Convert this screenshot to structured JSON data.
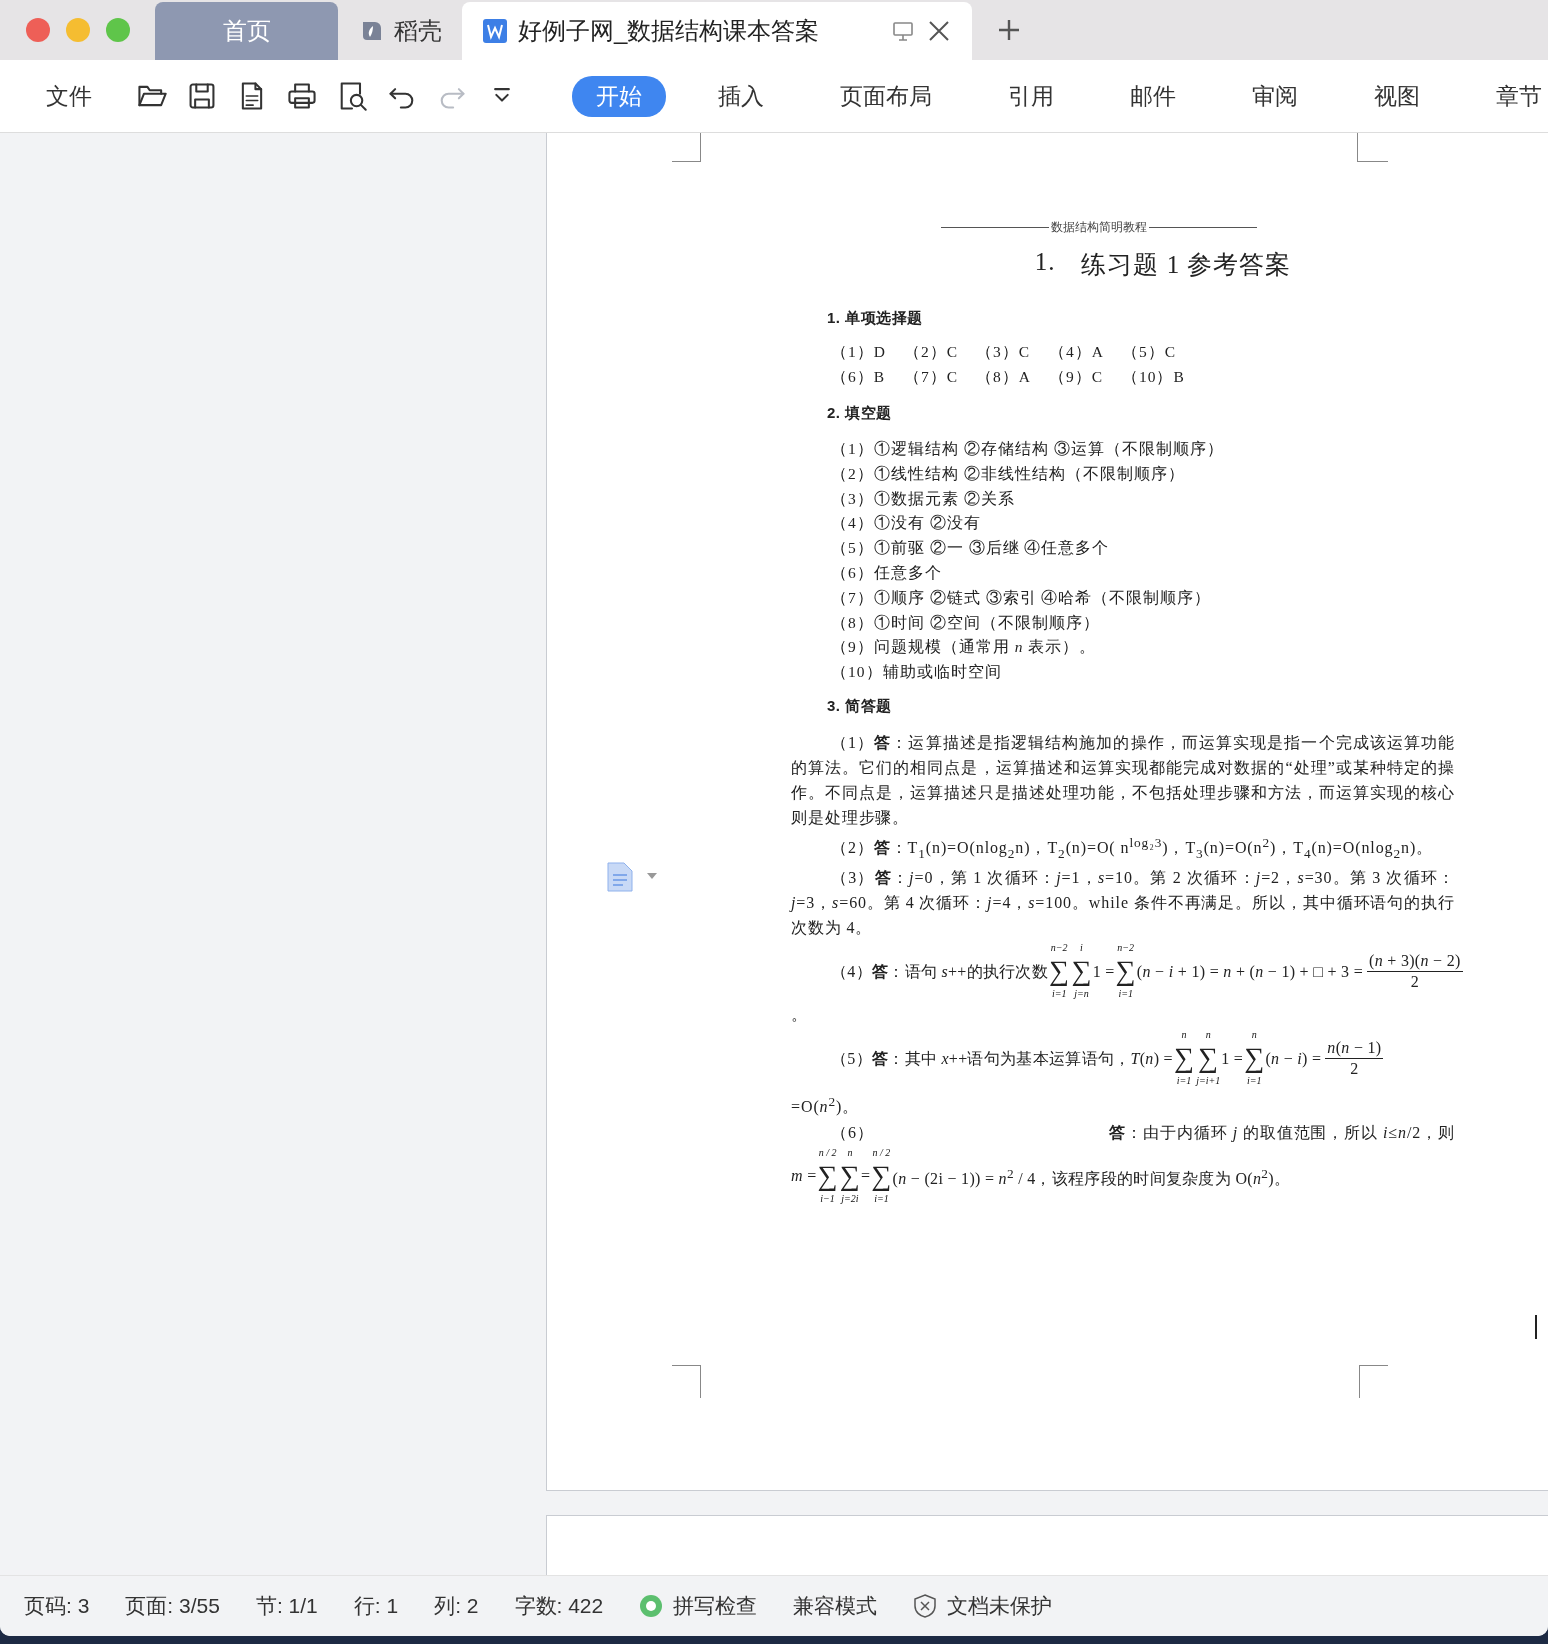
{
  "window": {
    "tabs": [
      {
        "kind": "home",
        "label": "首页",
        "selected": false
      },
      {
        "kind": "docer",
        "label": "稻壳",
        "selected": false
      },
      {
        "kind": "doc",
        "label": "好例子网_数据结构课本答案",
        "selected": true
      }
    ]
  },
  "toolbar": {
    "menu_label": "文件",
    "quick_access": [
      {
        "kind": "open",
        "disabled": false
      },
      {
        "kind": "save",
        "disabled": false
      },
      {
        "kind": "pdf",
        "disabled": false
      },
      {
        "kind": "print",
        "disabled": false
      },
      {
        "kind": "preview",
        "disabled": false
      },
      {
        "kind": "undo",
        "disabled": false
      },
      {
        "kind": "redo",
        "disabled": true
      },
      {
        "kind": "more",
        "disabled": false
      }
    ],
    "ribbon_tabs": [
      {
        "label": "开始",
        "selected": true
      },
      {
        "label": "插入",
        "selected": false
      },
      {
        "label": "页面布局",
        "selected": false
      },
      {
        "label": "引用",
        "selected": false
      },
      {
        "label": "邮件",
        "selected": false
      },
      {
        "label": "审阅",
        "selected": false
      },
      {
        "label": "视图",
        "selected": false
      },
      {
        "label": "章节",
        "selected": false
      }
    ]
  },
  "document": {
    "running_header": "数据结构简明教程",
    "title": {
      "number": "1.",
      "text": "练习题 1 参考答案"
    },
    "sections": [
      {
        "kind": "choices",
        "heading": "1. 单项选择题",
        "rows": [
          [
            "（1）D",
            "（2）C",
            "（3）C",
            "（4）A",
            "（5）C"
          ],
          [
            "（6）B",
            "（7）C",
            "（8）A",
            "（9）C",
            "（10）B"
          ]
        ]
      },
      {
        "kind": "list",
        "heading": "2. 填空题",
        "items": [
          "（1）①逻辑结构 ②存储结构 ③运算（不限制顺序）",
          "（2）①线性结构 ②非线性结构（不限制顺序）",
          "（3）①数据元素 ②关系",
          "（4）①没有 ②没有",
          "（5）①前驱 ②一 ③后继 ④任意多个",
          "（6）任意多个",
          "（7）①顺序 ②链式 ③索引 ④哈希（不限制顺序）",
          "（8）①时间 ②空间（不限制顺序）",
          "（9）问题规模（通常用 *n* 表示）。",
          "（10）辅助或临时空间"
        ]
      },
      {
        "kind": "answers",
        "heading": "3. 简答题",
        "items": [
          {
            "kind": "para",
            "indent": true,
            "text": "（1）**答**：运算描述是指逻辑结构施加的操作，而运算实现是指一个完成该运算功能的算法。它们的相同点是，运算描述和运算实现都能完成对数据的“处理”或某种特定的操作。不同点是，运算描述只是描述处理功能，不包括处理步骤和方法，而运算实现的核心则是处理步骤。"
          },
          {
            "kind": "para",
            "indent": true,
            "text": "（2）**答**：T$_{1}$(n)=O(nlog$_{2}$n)，T$_{2}$(n)=O( n$^{log₂3}$)，T$_{3}$(n)=O(n$^{2}$)，T$_{4}$(n)=O(nlog$_{2}$n)。"
          },
          {
            "kind": "para",
            "indent": true,
            "text": "（3）**答**：*j*=0，第 1 次循环：*j*=1，*s*=10。第 2 次循环：*j*=2，*s*=30。第 3 次循环：*j*=3，*s*=60。第 4 次循环：*j*=4，*s*=100。while 条件不再满足。所以，其中循环语句的执行次数为 4。"
          },
          {
            "kind": "math",
            "indent": true,
            "segments": [
              {
                "kind": "text",
                "text": "（4）**答**：语句 *s*++的执行次数"
              },
              {
                "kind": "sum",
                "symbol": "∑",
                "upper": "n−2",
                "lower": "i=1"
              },
              {
                "kind": "sum",
                "symbol": "∑",
                "upper": "i",
                "lower": "j=n"
              },
              {
                "kind": "text",
                "text": "1 ="
              },
              {
                "kind": "sum",
                "symbol": "∑",
                "upper": "n−2",
                "lower": "i=1"
              },
              {
                "kind": "text",
                "text": "(*n* − *i* + 1) = *n* + (*n* − 1) + □ + 3 ="
              },
              {
                "kind": "frac",
                "num": "(*n* + 3)(*n* − 2)",
                "den": "2"
              }
            ]
          },
          {
            "kind": "para",
            "indent": false,
            "text": "。"
          },
          {
            "kind": "math",
            "indent": true,
            "segments": [
              {
                "kind": "text",
                "text": "（5）**答**：其中 *x*++语句为基本运算语句，"
              },
              {
                "kind": "text",
                "text": "*T*(*n*) ="
              },
              {
                "kind": "sum",
                "symbol": "∑",
                "upper": "n",
                "lower": "i=1"
              },
              {
                "kind": "sum",
                "symbol": "∑",
                "upper": "n",
                "lower": "j=i+1"
              },
              {
                "kind": "text",
                "text": "1 ="
              },
              {
                "kind": "sum",
                "symbol": "∑",
                "upper": "n",
                "lower": "i=1"
              },
              {
                "kind": "text",
                "text": "(*n* − *i*) ="
              },
              {
                "kind": "frac",
                "num": "*n*(*n* − 1)",
                "den": "2"
              }
            ]
          },
          {
            "kind": "para",
            "indent": false,
            "text": "=O(*n*$^{2}$)。"
          },
          {
            "kind": "split",
            "left": "（6）",
            "right": "**答**：由于内循环 *j* 的取值范围，所以 *i*≤*n*/2，则"
          },
          {
            "kind": "math",
            "indent": false,
            "segments": [
              {
                "kind": "text",
                "text": "*m* ="
              },
              {
                "kind": "sum",
                "symbol": "∑",
                "upper": "n / 2",
                "lower": "i−1"
              },
              {
                "kind": "sum",
                "symbol": "∑",
                "upper": "n",
                "lower": "j=2i"
              },
              {
                "kind": "text",
                "text": "="
              },
              {
                "kind": "sum",
                "symbol": "∑",
                "upper": "n / 2",
                "lower": "i=1"
              },
              {
                "kind": "text",
                "text": "(*n* − (2i − 1)) = *n*$^{2}$ / 4，"
              },
              {
                "kind": "text",
                "text": "该程序段的时间复杂度为 O(*n*$^{2}$)。"
              }
            ]
          }
        ]
      }
    ]
  },
  "status_bar": [
    {
      "kind": "text",
      "label": "页码: 3"
    },
    {
      "kind": "text",
      "label": "页面: 3/55"
    },
    {
      "kind": "text",
      "label": "节: 1/1"
    },
    {
      "kind": "text",
      "label": "行: 1"
    },
    {
      "kind": "text",
      "label": "列: 2"
    },
    {
      "kind": "text",
      "label": "字数: 422"
    },
    {
      "kind": "spell",
      "label": "拼写检查"
    },
    {
      "kind": "text",
      "label": "兼容模式"
    },
    {
      "kind": "shield",
      "label": "文档未保护"
    }
  ]
}
